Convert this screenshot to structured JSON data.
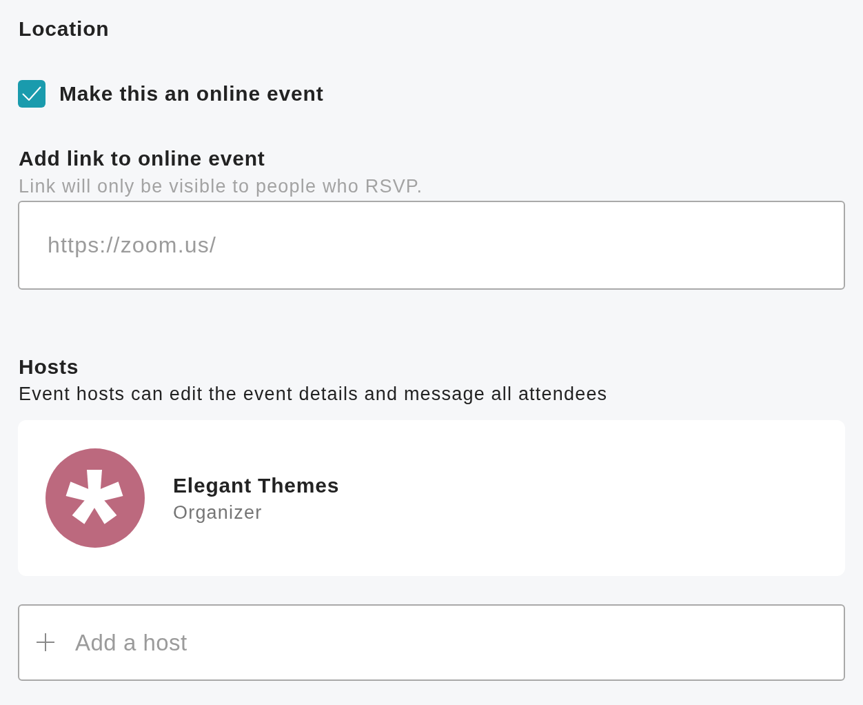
{
  "location": {
    "title": "Location",
    "online_checkbox": {
      "label": "Make this an online event",
      "checked": true
    },
    "link_field": {
      "label": "Add link to online event",
      "hint": "Link will only be visible to people who RSVP.",
      "placeholder": "https://zoom.us/"
    }
  },
  "hosts": {
    "title": "Hosts",
    "description": "Event hosts can edit the event details and message all attendees",
    "items": [
      {
        "name": "Elegant Themes",
        "role": "Organizer"
      }
    ],
    "add_field": {
      "placeholder": "Add a host"
    }
  }
}
